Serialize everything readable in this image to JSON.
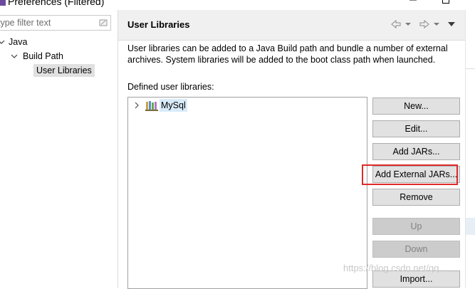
{
  "window": {
    "title": "Preferences (Filtered)"
  },
  "filter": {
    "placeholder": "type filter text",
    "clear_icon": "clear-filter-icon"
  },
  "tree": {
    "items": [
      {
        "label": "Java",
        "expanded": true
      },
      {
        "label": "Build Path",
        "expanded": true
      },
      {
        "label": "User Libraries",
        "selected": true
      }
    ]
  },
  "page": {
    "title": "User Libraries",
    "description": "User libraries can be added to a Java Build path and bundle a number of external archives. System libraries will be added to the boot class path when launched.",
    "defined_label": "Defined user libraries:",
    "nav_icons": [
      "back-arrow-icon",
      "forward-arrow-icon",
      "view-menu-icon"
    ]
  },
  "libraries": [
    {
      "name": "MySql",
      "icon": "library-jar-icon"
    }
  ],
  "buttons": {
    "new": "New...",
    "edit": "Edit...",
    "add_jars": "Add JARs...",
    "add_external_jars": "Add External JARs...",
    "remove": "Remove",
    "up": "Up",
    "down": "Down",
    "import": "Import..."
  },
  "watermark": "https://blog.csdn.net/qq...",
  "colors": {
    "highlight": "#e02a2a",
    "selection": "#d9ebf9"
  }
}
